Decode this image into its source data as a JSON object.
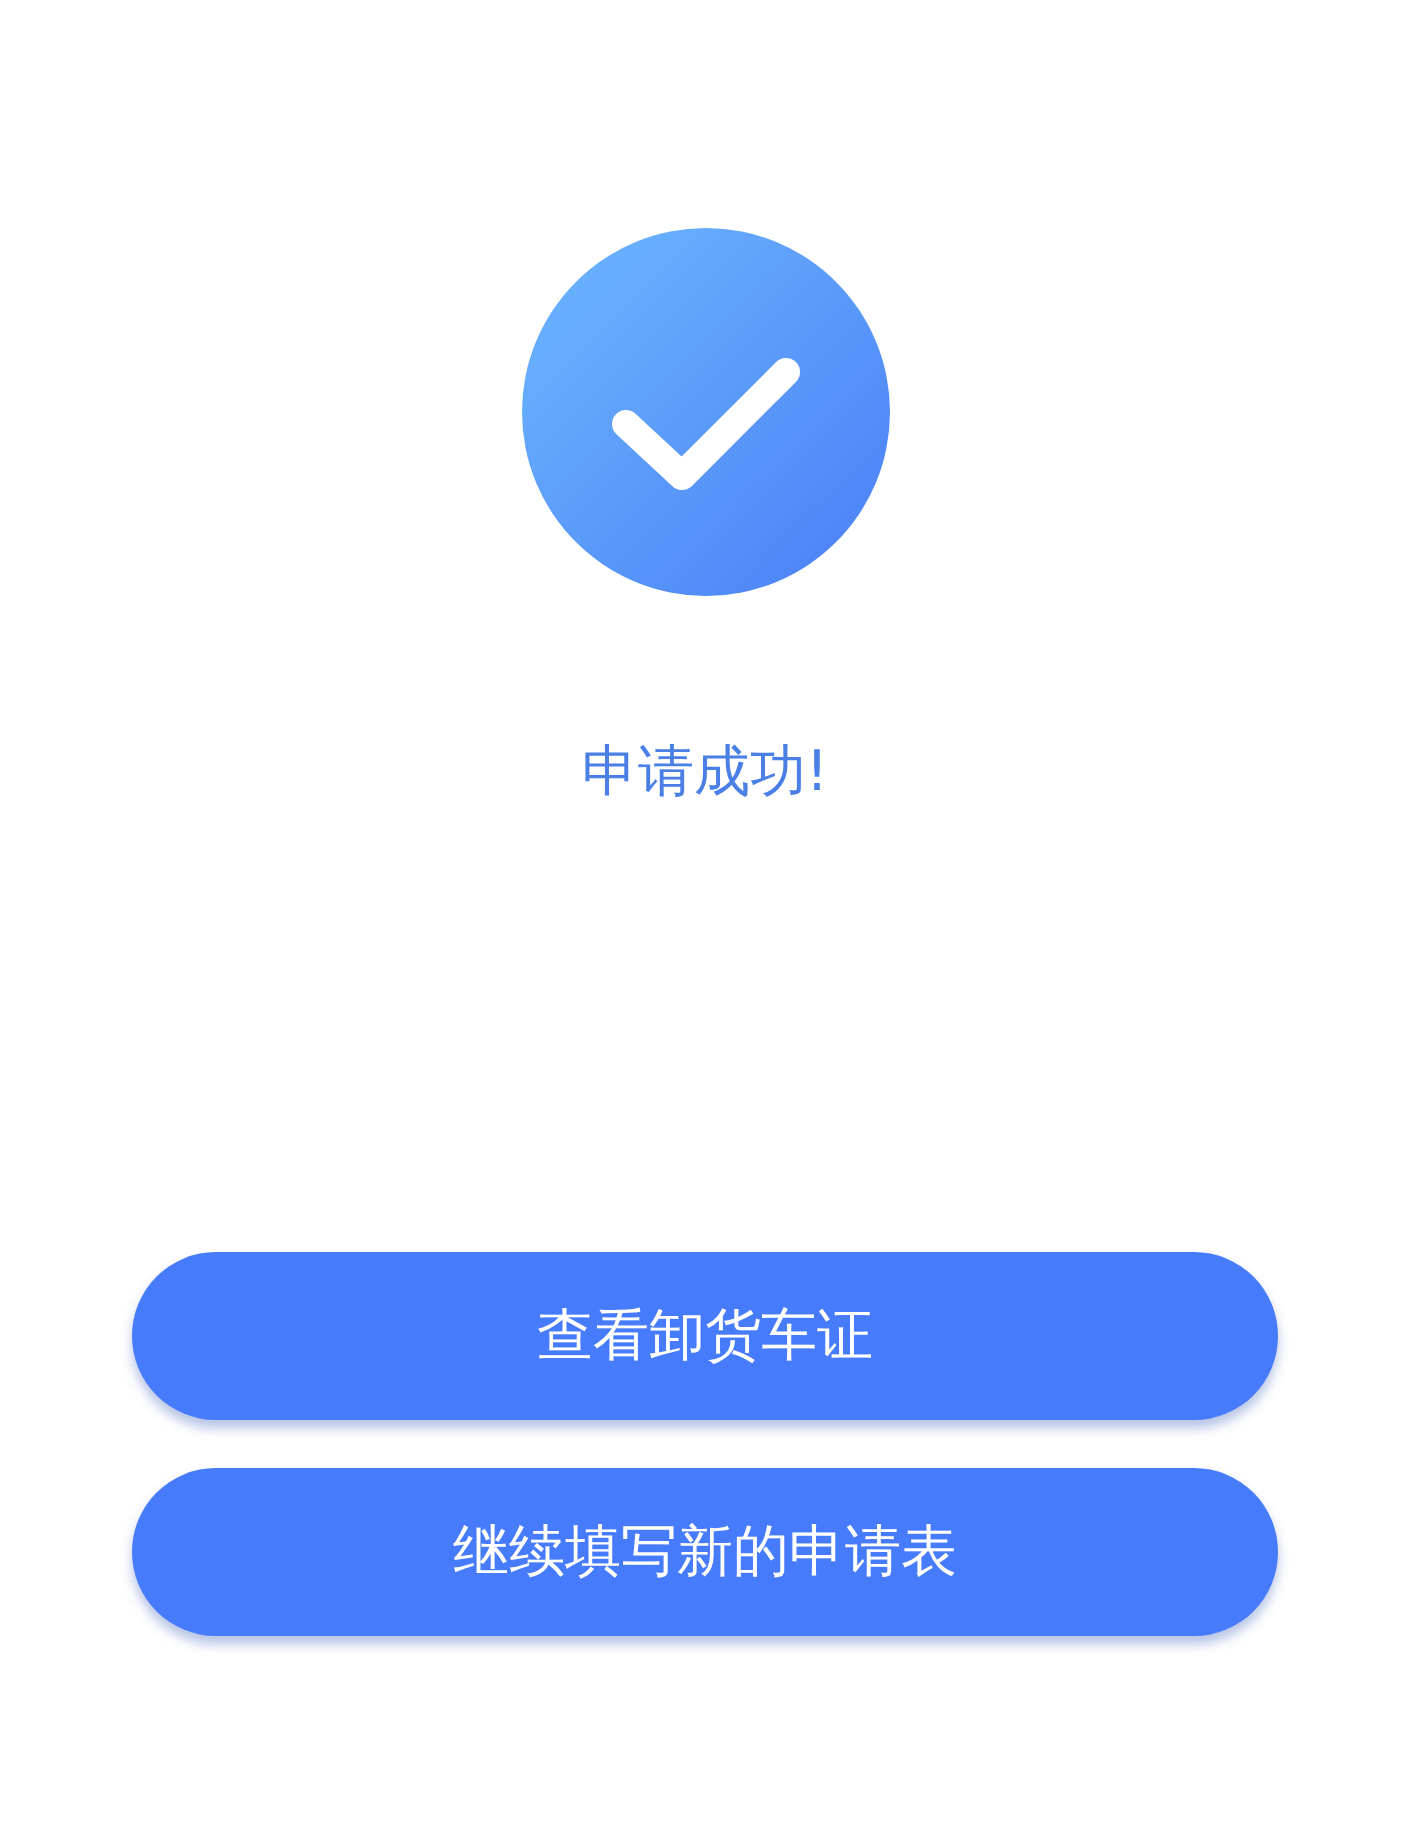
{
  "result": {
    "message": "申请成功!"
  },
  "buttons": [
    {
      "label": "查看卸货车证"
    },
    {
      "label": "继续填写新的申请表"
    }
  ]
}
